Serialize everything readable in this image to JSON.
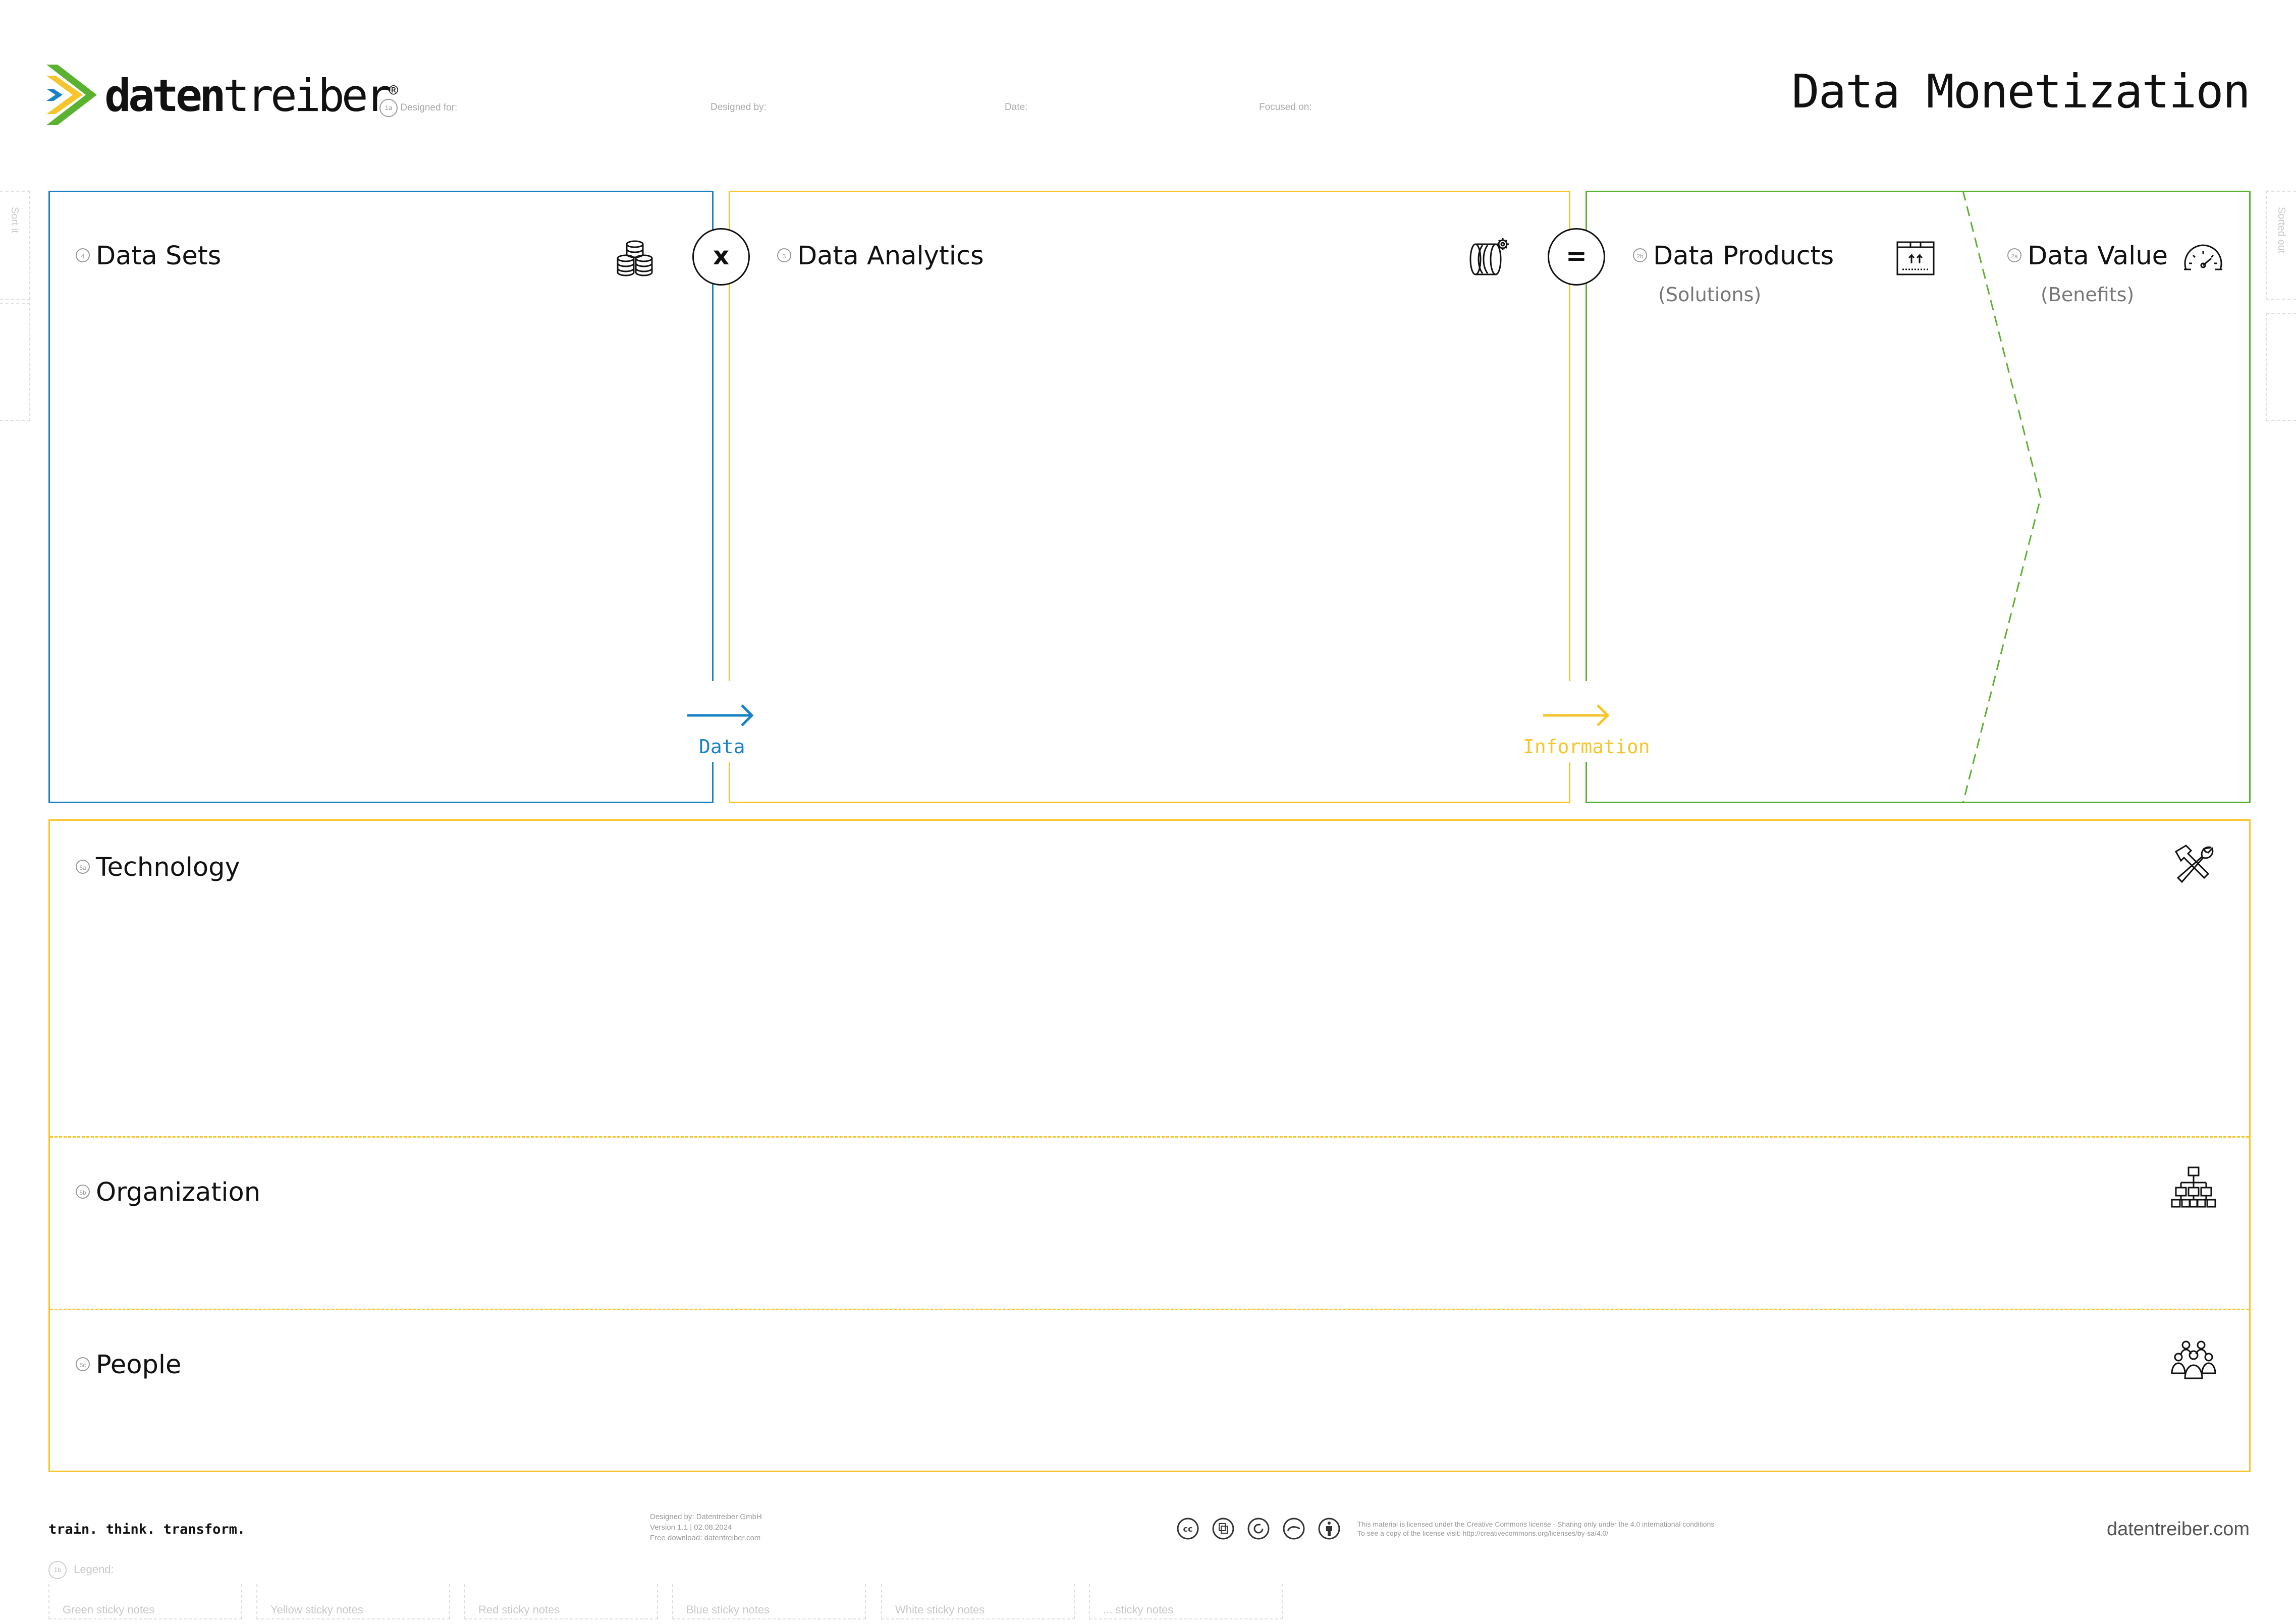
{
  "brand": {
    "logo_text": "datentreiber",
    "logo_text_bold": "daten",
    "logo_text_light": "treiber",
    "registered": "®",
    "colors": {
      "green": "#5bb130",
      "blue": "#1a82c4",
      "yellow": "#f7c52b"
    }
  },
  "header": {
    "step_number": "1a",
    "designed_for": "Designed for:",
    "designed_by": "Designed by:",
    "date": "Date:",
    "focused_on": "Focused on:",
    "canvas_title": "Data Monetization"
  },
  "side_tabs": {
    "left": "Sort it",
    "right": "Sorted out"
  },
  "sections": {
    "data_sets": {
      "num": "4",
      "title": "Data Sets",
      "color": "#1a82c4",
      "icon": "coins-stack-icon"
    },
    "data_analytics": {
      "num": "3",
      "title": "Data Analytics",
      "color": "#f7c52b",
      "icon": "data-cylinder-gear-icon"
    },
    "data_products": {
      "num": "2b",
      "title": "Data Products",
      "subtitle": "(Solutions)",
      "color": "#5bb130",
      "icon": "product-box-icon"
    },
    "data_value": {
      "num": "2a",
      "title": "Data Value",
      "subtitle": "(Benefits)",
      "color": "#5bb130",
      "icon": "speedometer-icon"
    },
    "technology": {
      "num": "5a",
      "title": "Technology",
      "icon": "tools-icon"
    },
    "organization": {
      "num": "5b",
      "title": "Organization",
      "icon": "org-chart-icon"
    },
    "people": {
      "num": "5c",
      "title": "People",
      "icon": "people-group-icon"
    }
  },
  "operators": {
    "multiply": "x",
    "equals": "="
  },
  "arrows": {
    "data": {
      "label": "Data",
      "color": "#1a82c4"
    },
    "information": {
      "label": "Information",
      "color": "#f7c52b"
    }
  },
  "footer": {
    "tagline": "train. think. transform.",
    "credits_line1": "Designed by: Datentreiber GmbH",
    "credits_line2": "Version 1.1 | 02.08.2024",
    "credits_line3": "Free download: datentreiber.com",
    "license_line1": "This material is licensed under the Creative Commons license - Sharing only under the 4.0 international conditions",
    "license_line2": "To see a copy of the license visit: http://creativecommons.org/licenses/by-sa/4.0/",
    "website": "datentreiber.com"
  },
  "legend": {
    "num": "1b",
    "label": "Legend:",
    "items": [
      "Green sticky notes",
      "Yellow sticky notes",
      "Red sticky notes",
      "Blue sticky notes",
      "White sticky notes",
      "... sticky notes"
    ]
  }
}
